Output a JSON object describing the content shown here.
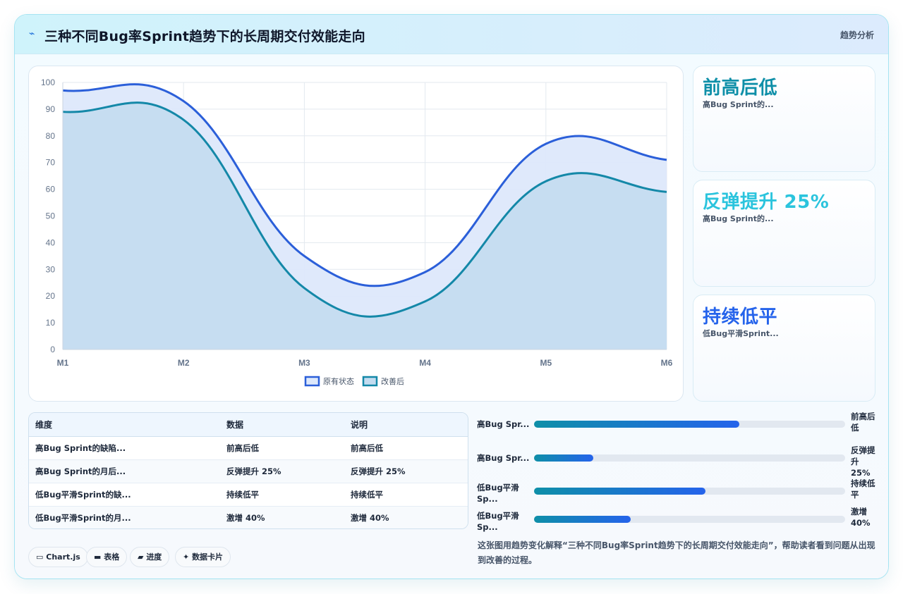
{
  "header": {
    "icon": "chart-line-icon",
    "title": "三种不同Bug率Sprint趋势下的长周期交付效能走向",
    "tag": "趋势分析"
  },
  "chart_data": {
    "type": "area",
    "categories": [
      "M1",
      "M2",
      "M3",
      "M4",
      "M5",
      "M6"
    ],
    "series": [
      {
        "name": "原有状态",
        "values": [
          97,
          93,
          35,
          29,
          77,
          71
        ],
        "color": "#2b5fd9",
        "fill": "#dde8fb"
      },
      {
        "name": "改善后",
        "values": [
          89,
          86,
          23,
          18,
          63,
          59
        ],
        "color": "#1488a8",
        "fill": "#c4dcf0"
      }
    ],
    "ylim": [
      0,
      100
    ],
    "yticks": [
      0,
      10,
      20,
      30,
      40,
      50,
      60,
      70,
      80,
      90,
      100
    ],
    "grid": true,
    "legend": "bottom"
  },
  "kpis": [
    {
      "value": "前高后低",
      "desc": "高Bug Sprint的...",
      "color": "#0e8fa8"
    },
    {
      "value": "反弹提升 25%",
      "desc": "高Bug Sprint的...",
      "color": "#2bc4dd"
    },
    {
      "value": "持续低平",
      "desc": "低Bug平滑Sprint...",
      "color": "#2563eb"
    }
  ],
  "table": {
    "headers": [
      "维度",
      "数据",
      "说明"
    ],
    "rows": [
      [
        "高Bug Sprint的缺陷...",
        "前高后低",
        "前高后低"
      ],
      [
        "高Bug Sprint的月后...",
        "反弹提升 25%",
        "反弹提升 25%"
      ],
      [
        "低Bug平滑Sprint的缺...",
        "持续低平",
        "持续低平"
      ],
      [
        "低Bug平滑Sprint的月...",
        "激增 40%",
        "激增 40%"
      ]
    ]
  },
  "chips": [
    {
      "icon": "monitor-icon",
      "glyph": "▭",
      "label": "Chart.js"
    },
    {
      "icon": "table-icon",
      "glyph": "▬",
      "label": "表格"
    },
    {
      "icon": "progress-icon",
      "glyph": "▰",
      "label": "进度"
    },
    {
      "icon": "sparkle-icon",
      "glyph": "✦",
      "label": "数据卡片"
    }
  ],
  "progress": [
    {
      "label": "高Bug Spr...",
      "value_text": "前高后低",
      "fraction": 0.66
    },
    {
      "label": "高Bug Spr...",
      "value_text": "反弹提升 25%",
      "fraction": 0.19
    },
    {
      "label": "低Bug平滑Sp...",
      "value_text": "持续低平",
      "fraction": 0.55
    },
    {
      "label": "低Bug平滑Sp...",
      "value_text": "激增 40%",
      "fraction": 0.31
    }
  ],
  "note": "这张图用趋势变化解释“三种不同Bug率Sprint趋势下的长周期交付效能走向”，帮助读者看到问题从出现到改善的过程。"
}
